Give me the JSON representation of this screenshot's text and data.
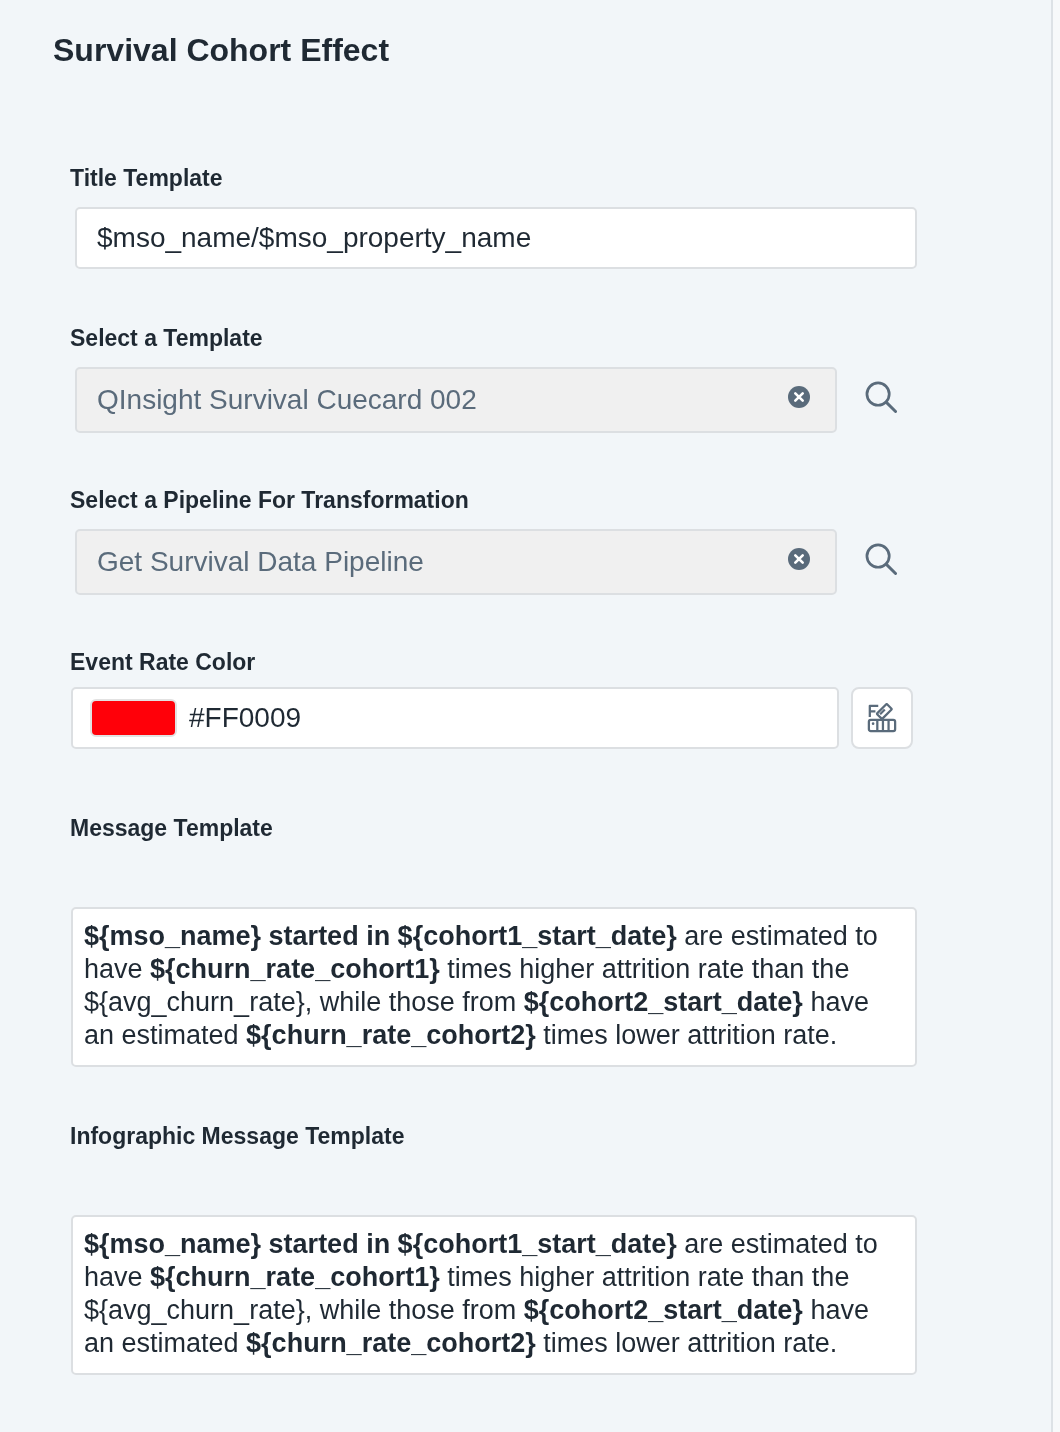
{
  "panel": {
    "title": "Survival Cohort Effect"
  },
  "fields": [
    {
      "kind": "text",
      "label": "Title Template",
      "value": "$mso_name/$mso_property_name"
    },
    {
      "kind": "lookup",
      "label": "Select a Template",
      "value": "QInsight Survival Cuecard 002"
    },
    {
      "kind": "lookup",
      "label": "Select a Pipeline For Transformation",
      "value": "Get Survival Data Pipeline"
    },
    {
      "kind": "color",
      "label": "Event Rate Color",
      "value": "#FF0009"
    },
    {
      "kind": "richtext",
      "label": "Message Template",
      "value": "**${mso_name} started in ${cohort1_start_date}** are estimated to have **${churn_rate_cohort1}** times higher attrition rate than the ${avg_churn_rate}, while those from **${cohort2_start_date}** have an estimated **${churn_rate_cohort2}** times lower attrition rate."
    },
    {
      "kind": "richtext",
      "label": "Infographic Message Template",
      "value": "**${mso_name} started in ${cohort1_start_date}** are estimated to have **${churn_rate_cohort1}** times higher attrition rate than the ${avg_churn_rate}, while those from **${cohort2_start_date}** have an estimated **${churn_rate_cohort2}** times lower attrition rate."
    }
  ]
}
